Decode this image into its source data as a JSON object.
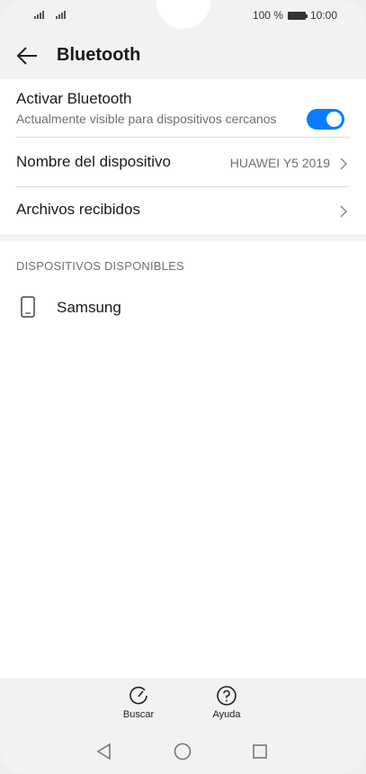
{
  "status_bar": {
    "battery_percent": "100 %",
    "time": "10:00"
  },
  "header": {
    "title": "Bluetooth",
    "back_icon": "arrow-left-icon"
  },
  "settings": {
    "activate": {
      "label": "Activar Bluetooth",
      "sublabel": "Actualmente visible para dispositivos cercanos",
      "enabled": true,
      "accent_color": "#0a7cff"
    },
    "device_name": {
      "label": "Nombre del dispositivo",
      "value": "HUAWEI Y5 2019"
    },
    "received_files": {
      "label": "Archivos recibidos"
    }
  },
  "available": {
    "header": "DISPOSITIVOS DISPONIBLES",
    "devices": [
      {
        "name": "Samsung",
        "icon": "phone-icon"
      }
    ]
  },
  "bottom_actions": [
    {
      "label": "Buscar",
      "icon": "refresh-icon"
    },
    {
      "label": "Ayuda",
      "icon": "help-icon"
    }
  ],
  "nav": [
    "back-triangle-icon",
    "home-circle-icon",
    "recents-square-icon"
  ]
}
